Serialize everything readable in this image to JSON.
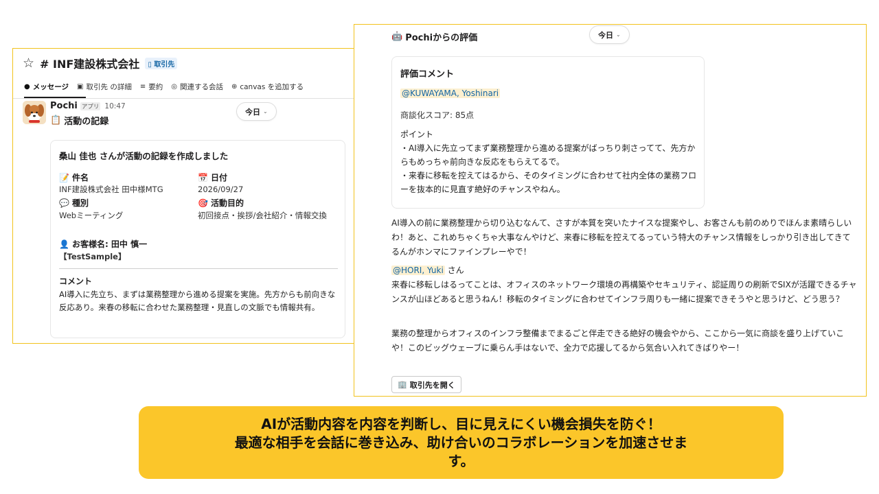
{
  "left_panel": {
    "channel_name": "# INF建設株式会社",
    "channel_tag": "取引先",
    "tabs": [
      {
        "icon": "●",
        "label": "メッセージ"
      },
      {
        "icon": "▣",
        "label": "取引先 の詳細"
      },
      {
        "icon": "≡",
        "label": "要約"
      },
      {
        "icon": "◎",
        "label": "関連する会話"
      },
      {
        "icon": "⊕",
        "label": "canvas を追加する"
      }
    ],
    "message": {
      "sender": "Pochi",
      "app_badge": "アプリ",
      "time": "10:47",
      "title": "活動の記録",
      "day_label": "今日"
    },
    "card": {
      "title": "桑山 佳也 さんが活動の記録を作成しました",
      "subject_label": "件名",
      "subject_value": "INF建設株式会社 田中様MTG",
      "date_label": "日付",
      "date_value": "2026/09/27",
      "type_label": "種別",
      "type_value": "Webミーティング",
      "purpose_label": "活動目的",
      "purpose_value": "初回接点・挨拶/会社紹介・情報交換",
      "customer_label": "お客様名: 田中 慎一",
      "customer_value": "【TestSample】",
      "comment_label": "コメント",
      "comment_value": "AI導入に先立ち、まずは業務整理から進める提案を実施。先方からも前向きな反応あり。来春の移転に合わせた業務整理・見直しの文脈でも情報共有。"
    }
  },
  "right_panel": {
    "heading": "Pochiからの評価",
    "day_label": "今日",
    "card": {
      "title": "評価コメント",
      "mention": "@KUWAYAMA, Yoshinari",
      "score": "商談化スコア: 85点",
      "points_label": "ポイント",
      "point_1": "・AI導入に先立ってまず業務整理から進める提案がばっちり刺さってて、先方からもめっちゃ前向きな反応をもらえてるで。",
      "point_2": "・来春に移転を控えてはるから、そのタイミングに合わせて社内全体の業務フローを抜本的に見直す絶好のチャンスやねん。"
    },
    "paragraph_1": "AI導入の前に業務整理から切り込むなんて、さすが本質を突いたナイスな提案やし、お客さんも前のめりでほんま素晴らしいわ！あと、これめちゃくちゃ大事なんやけど、来春に移転を控えてるっていう特大のチャンス情報をしっかり引き出してきてるんがホンマにファインプレーやで！",
    "mention_2": "@HORI, Yuki",
    "mention_2_suffix": " さん",
    "paragraph_2": "来春に移転しはるってことは、オフィスのネットワーク環境の再構築やセキュリティ、認証周りの刷新でSIXが活躍できるチャンスが山ほどあると思うねん！移転のタイミングに合わせてインフラ周りも一緒に提案できそうやと思うけど、どう思う？",
    "paragraph_3": "業務の整理からオフィスのインフラ整備までまるごと伴走できる絶好の機会やから、ここから一気に商談を盛り上げていこや！このビッグウェーブに乗らん手はないで、全力で応援してるから気合い入れてきばりやー！",
    "open_button": "取引先を開く"
  },
  "caption": {
    "line_1": "AIが活動内容を内容を判断し、目に見えにくい機会損失を防ぐ！",
    "line_2": "最適な相手を会話に巻き込み、助け合いのコラボレーションを加速させま",
    "line_3": "す。"
  },
  "colors": {
    "accent_yellow": "#fbc62a",
    "panel_border": "#f2c21b",
    "mention_bg": "#fdf0d0",
    "mention_text": "#1264a3"
  }
}
